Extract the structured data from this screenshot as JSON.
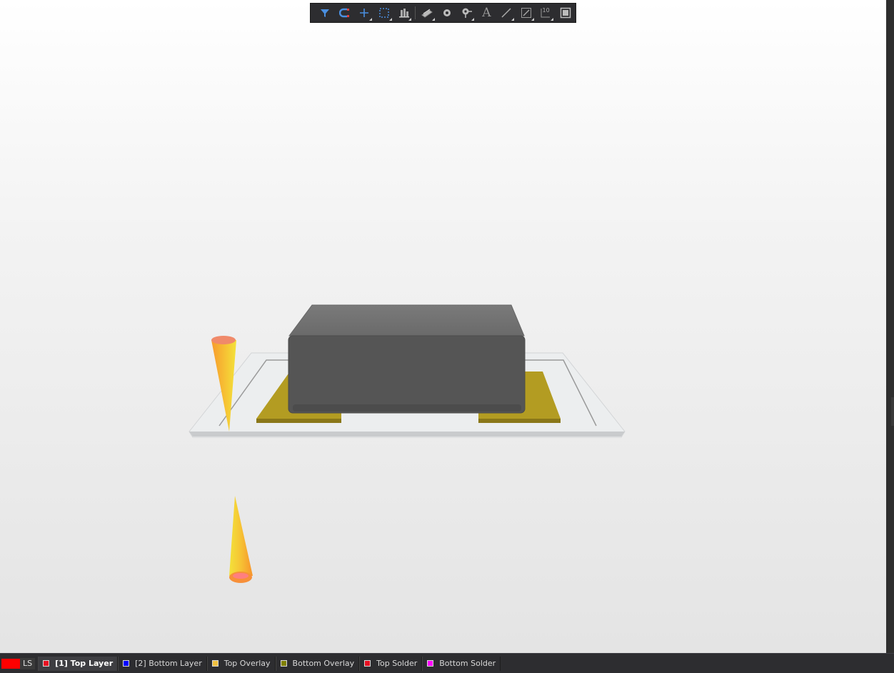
{
  "toolbar": {
    "buttons": [
      {
        "name": "filter-icon",
        "dropdown": false
      },
      {
        "name": "snap-magnet-icon",
        "dropdown": false
      },
      {
        "name": "crosshair-add-icon",
        "dropdown": true
      },
      {
        "name": "select-rectangle-icon",
        "dropdown": true
      },
      {
        "name": "align-icon",
        "dropdown": true
      },
      {
        "name": "component-place-icon",
        "dropdown": true
      },
      {
        "name": "via-icon",
        "dropdown": false
      },
      {
        "name": "pad-icon",
        "dropdown": true
      },
      {
        "name": "text-icon",
        "dropdown": false
      },
      {
        "name": "line-icon",
        "dropdown": true
      },
      {
        "name": "dimension-icon",
        "dropdown": true
      },
      {
        "name": "designator-icon",
        "dropdown": true
      },
      {
        "name": "region-icon",
        "dropdown": false
      }
    ],
    "text_glyph": "A",
    "designator_glyph": "10"
  },
  "status": {
    "layer_set_label": "LS",
    "current_layer_color": "#ff0000"
  },
  "layers": [
    {
      "label": "[1] Top Layer",
      "color": "#e81123",
      "active": true
    },
    {
      "label": "[2] Bottom Layer",
      "color": "#0000ff",
      "active": false
    },
    {
      "label": "Top Overlay",
      "color": "#f0c040",
      "active": false
    },
    {
      "label": "Bottom Overlay",
      "color": "#808000",
      "active": false
    },
    {
      "label": "Top Solder",
      "color": "#e81123",
      "active": false
    },
    {
      "label": "Bottom Solder",
      "color": "#ff00ff",
      "active": false
    }
  ],
  "colors": {
    "pad": "#b39c22",
    "body": "#555555",
    "board_outline": "#9a9a9a",
    "accent_blue": "#4a8fe0"
  }
}
